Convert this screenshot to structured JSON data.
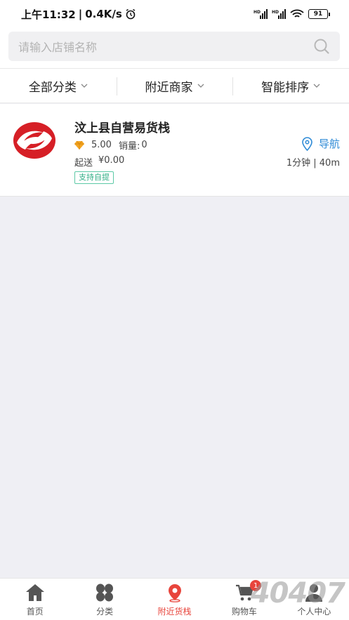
{
  "status_bar": {
    "time": "上午11:32",
    "speed": "0.4K/s",
    "battery": "91"
  },
  "search": {
    "placeholder": "请输入店铺名称"
  },
  "filters": [
    {
      "label": "全部分类"
    },
    {
      "label": "附近商家"
    },
    {
      "label": "智能排序"
    }
  ],
  "store": {
    "name": "汶上县自营易货栈",
    "rating": "5.00",
    "sales_label": "销量:",
    "sales_value": "0",
    "min_label": "起送",
    "min_value": "¥0.00",
    "tag": "支持自提",
    "nav_label": "导航",
    "distance": "1分钟 | 40m"
  },
  "tabs": [
    {
      "label": "首页",
      "icon": "home-icon"
    },
    {
      "label": "分类",
      "icon": "category-icon"
    },
    {
      "label": "附近货栈",
      "icon": "location-icon",
      "active": true
    },
    {
      "label": "购物车",
      "icon": "cart-icon",
      "badge": "1"
    },
    {
      "label": "个人中心",
      "icon": "user-icon"
    }
  ],
  "watermark": "40407",
  "colors": {
    "accent": "#e8453c",
    "link": "#2d8ad6",
    "tag": "#2fae85",
    "background": "#efeff4"
  }
}
